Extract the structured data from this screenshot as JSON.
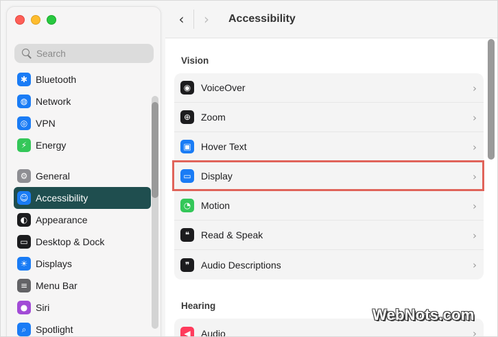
{
  "window": {
    "title": "Accessibility"
  },
  "sidebar": {
    "search_placeholder": "Search",
    "items": [
      {
        "label": "Bluetooth",
        "icon": "bluetooth-icon",
        "color": "#1a7cf5",
        "glyph": "✱"
      },
      {
        "label": "Network",
        "icon": "globe-icon",
        "color": "#1a7cf5",
        "glyph": "◍"
      },
      {
        "label": "VPN",
        "icon": "vpn-globe-icon",
        "color": "#1a7cf5",
        "glyph": "◎"
      },
      {
        "label": "Energy",
        "icon": "battery-bolt-icon",
        "color": "#34c759",
        "glyph": "⚡"
      },
      {
        "label": "General",
        "icon": "gear-icon",
        "color": "#8e8e93",
        "glyph": "⚙"
      },
      {
        "label": "Accessibility",
        "icon": "accessibility-icon",
        "color": "#1a7cf5",
        "glyph": "☺",
        "selected": true
      },
      {
        "label": "Appearance",
        "icon": "appearance-icon",
        "color": "#1c1c1e",
        "glyph": "◐"
      },
      {
        "label": "Desktop & Dock",
        "icon": "dock-icon",
        "color": "#1c1c1e",
        "glyph": "▭"
      },
      {
        "label": "Displays",
        "icon": "sun-icon",
        "color": "#1a7cf5",
        "glyph": "☀"
      },
      {
        "label": "Menu Bar",
        "icon": "menu-bar-icon",
        "color": "#636366",
        "glyph": "≡"
      },
      {
        "label": "Siri",
        "icon": "siri-icon",
        "color": "#a24bd6",
        "glyph": "●"
      },
      {
        "label": "Spotlight",
        "icon": "spotlight-icon",
        "color": "#1a7cf5",
        "glyph": "⌕"
      }
    ]
  },
  "toolbar": {
    "back": "‹",
    "forward": "›"
  },
  "sections": [
    {
      "title": "Vision",
      "rows": [
        {
          "label": "VoiceOver",
          "icon": "voiceover-icon",
          "color": "#1c1c1e",
          "glyph": "◉"
        },
        {
          "label": "Zoom",
          "icon": "zoom-icon",
          "color": "#1c1c1e",
          "glyph": "⊕"
        },
        {
          "label": "Hover Text",
          "icon": "hover-text-icon",
          "color": "#1a7cf5",
          "glyph": "▣"
        },
        {
          "label": "Display",
          "icon": "display-icon",
          "color": "#1a7cf5",
          "glyph": "▭"
        },
        {
          "label": "Motion",
          "icon": "motion-icon",
          "color": "#34c759",
          "glyph": "◔"
        },
        {
          "label": "Read & Speak",
          "icon": "read-speak-icon",
          "color": "#1c1c1e",
          "glyph": "❝"
        },
        {
          "label": "Audio Descriptions",
          "icon": "audio-descriptions-icon",
          "color": "#1c1c1e",
          "glyph": "❞"
        }
      ]
    },
    {
      "title": "Hearing",
      "rows": [
        {
          "label": "Audio",
          "icon": "speaker-icon",
          "color": "#ff3b5c",
          "glyph": "◀"
        }
      ]
    }
  ],
  "chevron": "›",
  "watermark": "WebNots.com"
}
